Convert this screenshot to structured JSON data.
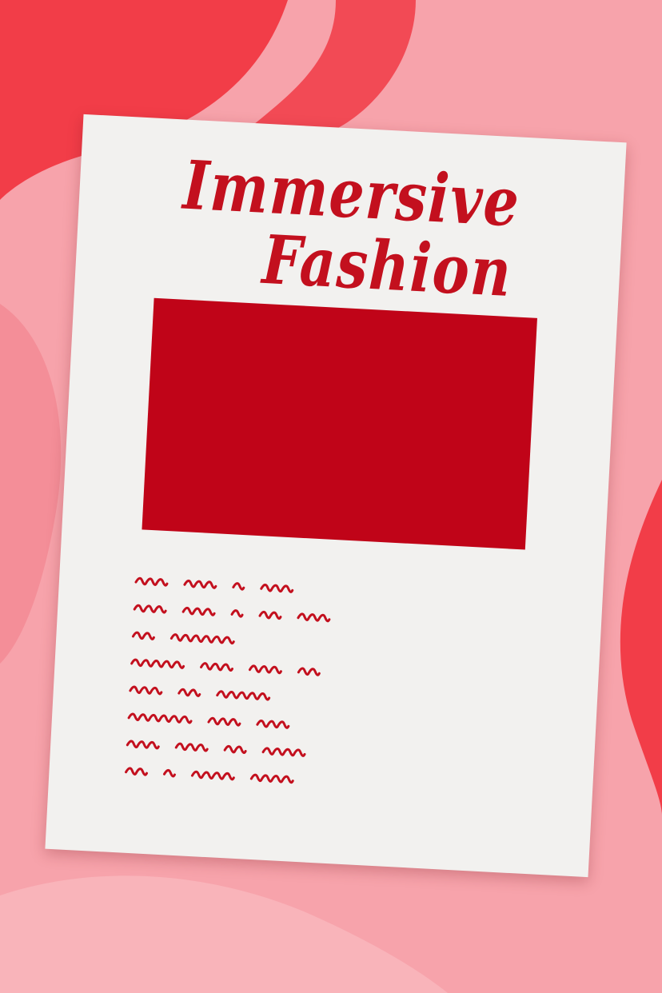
{
  "poster": {
    "title_line_1": "Immersive",
    "title_line_2": "Fashion",
    "squiggle_lines_words": [
      [
        3,
        3,
        1,
        3
      ],
      [
        3,
        3,
        1,
        2,
        3
      ],
      [
        2,
        6
      ],
      [
        5,
        3,
        3,
        2
      ],
      [
        3,
        2,
        5
      ],
      [
        6,
        3,
        3
      ],
      [
        3,
        3,
        2,
        4
      ],
      [
        2,
        1,
        4,
        4
      ]
    ]
  },
  "colors": {
    "background_pink": "#f7a3ab",
    "background_red": "#f23d48",
    "poster_paper": "#f2f1ef",
    "accent_red": "#c3101e",
    "block_red": "#c00418"
  }
}
